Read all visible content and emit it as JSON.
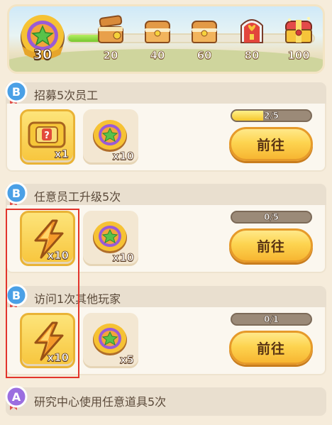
{
  "level": {
    "value": "30",
    "progress_fraction": 0.2
  },
  "milestones": [
    {
      "label": "20",
      "chest": "wooden-chest-opened"
    },
    {
      "label": "40",
      "chest": "wooden-chest"
    },
    {
      "label": "60",
      "chest": "wooden-chest"
    },
    {
      "label": "80",
      "chest": "red-gift-chest"
    },
    {
      "label": "100",
      "chest": "golden-chest"
    }
  ],
  "tasks": [
    {
      "grade": "B",
      "title": "招募5次员工",
      "rewards": [
        {
          "icon": "ticket-icon",
          "qty": "x1"
        },
        {
          "icon": "star-coin-icon",
          "qty": "x10"
        }
      ],
      "progress_text": "2/5",
      "progress_fraction": 0.4,
      "button": "前往"
    },
    {
      "grade": "B",
      "title": "任意员工升级5次",
      "rewards": [
        {
          "icon": "lightning-icon",
          "qty": "x10"
        },
        {
          "icon": "star-coin-icon",
          "qty": "x10"
        }
      ],
      "progress_text": "0/5",
      "progress_fraction": 0,
      "button": "前往"
    },
    {
      "grade": "B",
      "title": "访问1次其他玩家",
      "rewards": [
        {
          "icon": "lightning-icon",
          "qty": "x10"
        },
        {
          "icon": "star-coin-icon",
          "qty": "x5"
        }
      ],
      "progress_text": "0/1",
      "progress_fraction": 0,
      "button": "前往"
    },
    {
      "grade": "A",
      "title": "研究中心使用任意道具5次"
    }
  ],
  "colors": {
    "grade_b": "#4aa0e6",
    "grade_a": "#9b6ee0",
    "highlight": "#e2342b",
    "button_gold": "#fdd450"
  }
}
